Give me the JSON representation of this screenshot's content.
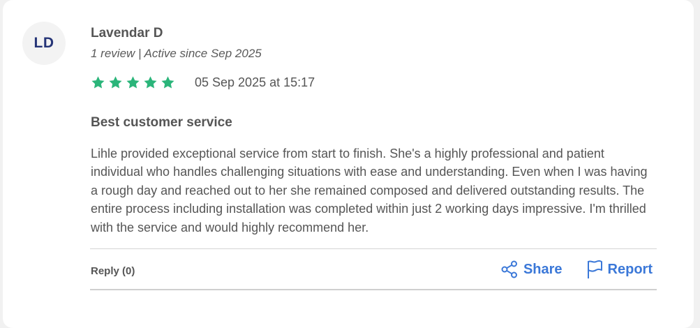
{
  "review": {
    "avatar_initials": "LD",
    "author_name": "Lavendar D",
    "author_meta": "1 review | Active since Sep 2025",
    "rating": 5,
    "star_color": "#2bb57a",
    "date": "05 Sep 2025 at 15:17",
    "title": "Best customer service",
    "body": "Lihle provided exceptional service from start to finish. She's a highly professional and patient individual who handles challenging situations with ease and understanding. Even when I was having a rough day and reached out to her she remained composed and delivered outstanding results. The entire process including installation was completed within just 2 working days impressive. I'm thrilled with the service and would highly recommend her."
  },
  "footer": {
    "reply_label": "Reply (0)",
    "share_label": "Share",
    "report_label": "Report",
    "link_color": "#3b78d8"
  },
  "icons": {
    "star": "star-icon",
    "share": "share-icon",
    "report": "flag-icon"
  }
}
